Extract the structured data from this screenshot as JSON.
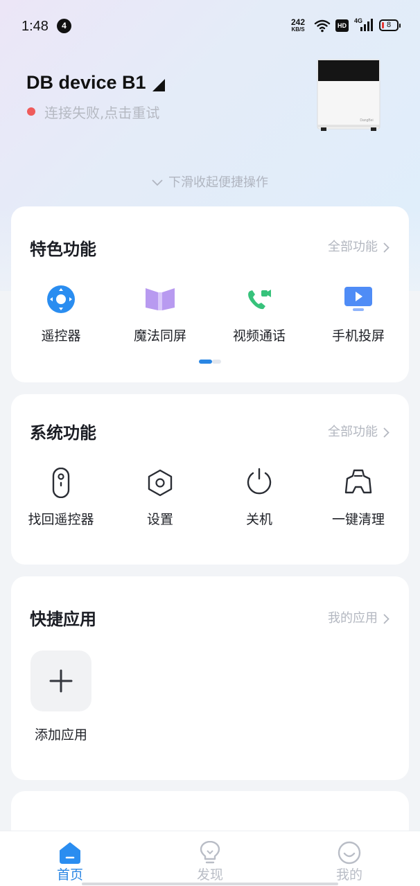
{
  "status_bar": {
    "time": "1:48",
    "notification_count": "4",
    "net_speed_value": "242",
    "net_speed_unit": "KB/S",
    "hd_label": "HD",
    "network_type": "4G",
    "battery_level": "8"
  },
  "device": {
    "name": "DB device B1",
    "connection_status": "连接失败,点击重试",
    "status_color": "#ef5b5b"
  },
  "collapse_hint": "下滑收起便捷操作",
  "featured": {
    "title": "特色功能",
    "more_label": "全部功能",
    "items": [
      {
        "label": "遥控器",
        "icon": "remote-control-icon"
      },
      {
        "label": "魔法同屏",
        "icon": "screen-mirror-icon"
      },
      {
        "label": "视频通话",
        "icon": "video-call-icon"
      },
      {
        "label": "手机投屏",
        "icon": "phone-cast-icon"
      }
    ],
    "page_index": 1,
    "page_count": 2
  },
  "system": {
    "title": "系统功能",
    "more_label": "全部功能",
    "items": [
      {
        "label": "找回遥控器",
        "icon": "find-remote-icon"
      },
      {
        "label": "设置",
        "icon": "settings-icon"
      },
      {
        "label": "关机",
        "icon": "power-icon"
      },
      {
        "label": "一键清理",
        "icon": "clean-icon"
      }
    ]
  },
  "quick_apps": {
    "title": "快捷应用",
    "more_label": "我的应用",
    "add_label": "添加应用"
  },
  "bottom_nav": {
    "items": [
      {
        "label": "首页",
        "icon": "home-icon",
        "active": true
      },
      {
        "label": "发现",
        "icon": "lightbulb-icon",
        "active": false
      },
      {
        "label": "我的",
        "icon": "smiley-icon",
        "active": false
      }
    ]
  },
  "colors": {
    "accent": "#2a86e3",
    "text_primary": "#1b1d24",
    "text_muted": "#b3b7c0",
    "nav_inactive": "#b9bdc6"
  }
}
